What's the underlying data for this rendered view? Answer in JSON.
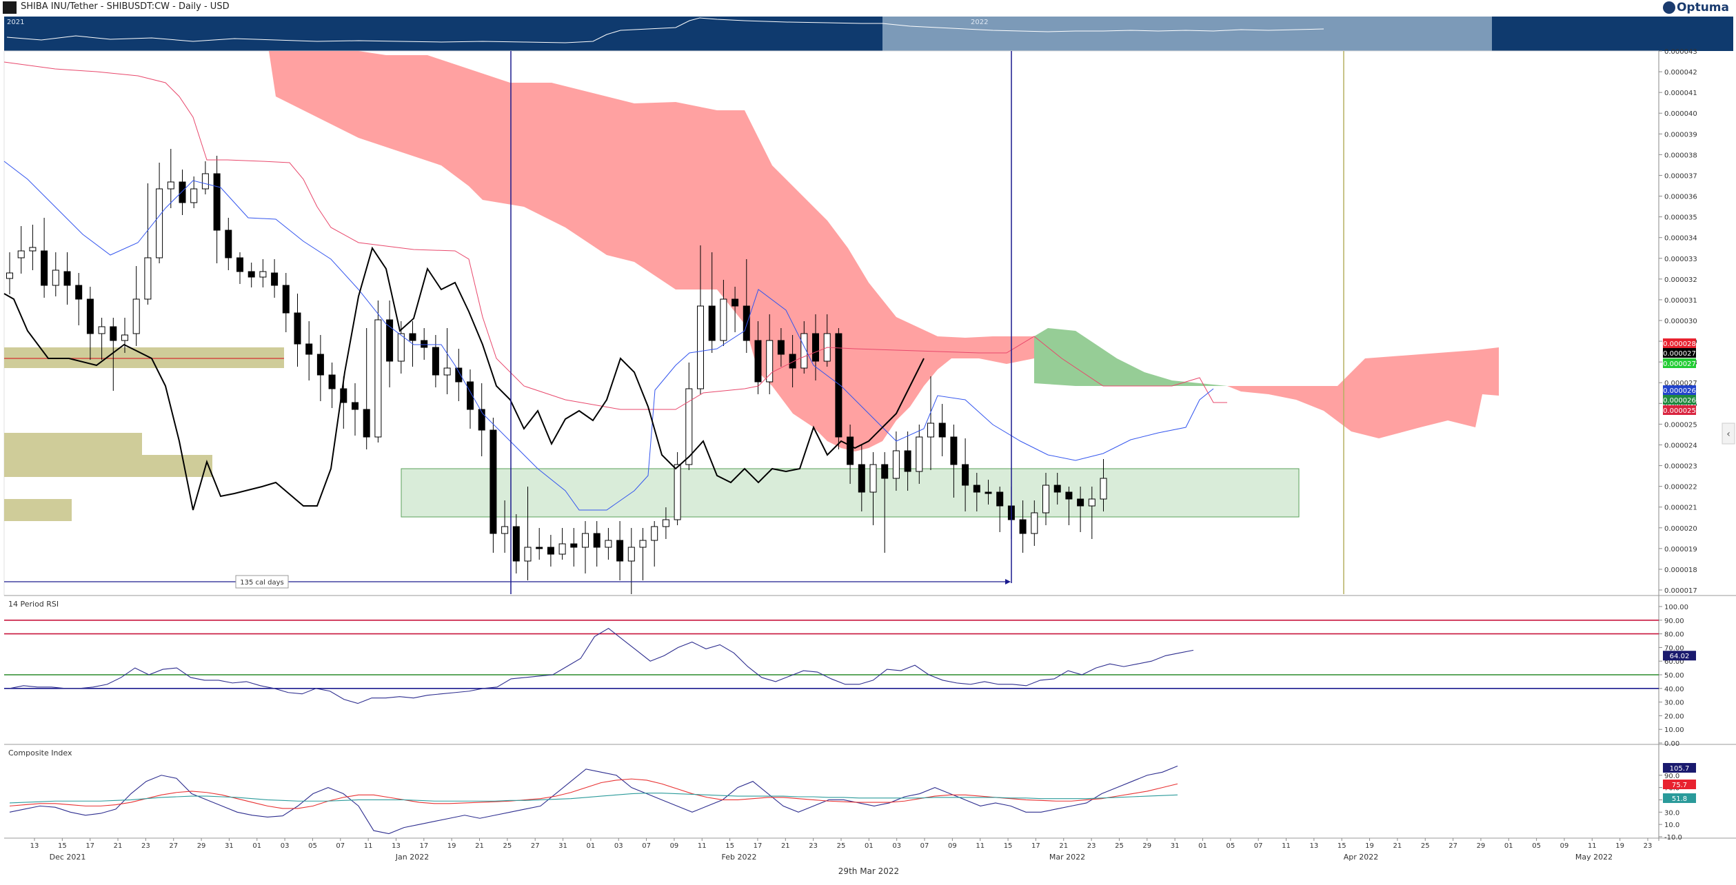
{
  "header": {
    "title": "SHIBA INU/Tether - SHIBUSDT:CW - Daily - USD",
    "logo": "Optuma",
    "menu_icon": "chart-menu-icon"
  },
  "navigator": {
    "year_labels": [
      "2021",
      "2022"
    ]
  },
  "colors": {
    "navigator_bg": "#0f3a6e",
    "cloud_bearish": "#ff8a8a",
    "cloud_bullish": "#7cc07c",
    "kijun": "#e8476b",
    "tenkan": "#3355ee",
    "chikou": "#000000",
    "support_zone": "#d9ecd9",
    "supply_zone": "#cfcc99"
  },
  "chart_data": [
    {
      "type": "candlestick",
      "panel": "price",
      "title": "SHIBA INU/Tether - SHIBUSDT:CW - Daily - USD",
      "ylim": [
        1.7e-05,
        4.3e-05
      ],
      "y_ticks": [
        "0.000017",
        "0.000018",
        "0.000019",
        "0.000020",
        "0.000021",
        "0.000022",
        "0.000023",
        "0.000024",
        "0.000025",
        "0.000026",
        "0.000027",
        "0.000028",
        "0.000029",
        "0.000030",
        "0.000031",
        "0.000032",
        "0.000033",
        "0.000034",
        "0.000035",
        "0.000036",
        "0.000037",
        "0.000038",
        "0.000039",
        "0.000040",
        "0.000041",
        "0.000042",
        "0.000043"
      ],
      "last_values": [
        {
          "label": "0.000028",
          "color": "#e8222f"
        },
        {
          "label": "0.000027",
          "color": "#000000"
        },
        {
          "label": "0.000027",
          "color": "#22cc33"
        },
        {
          "label": "0.000026",
          "color": "#2244cc"
        },
        {
          "label": "0.000026",
          "color": "#1f8a3f"
        },
        {
          "label": "0.000025",
          "color": "#d9243f"
        }
      ],
      "annotation": "135 cal days",
      "indicators": [
        "Ichimoku Cloud",
        "Tenkan-sen",
        "Kijun-sen",
        "Chikou Span"
      ],
      "grid": false
    },
    {
      "type": "line",
      "panel": "rsi",
      "title": "14 Period RSI",
      "ylim": [
        0,
        100
      ],
      "y_ticks": [
        "0.00",
        "10.00",
        "20.00",
        "30.00",
        "40.00",
        "50.00",
        "60.00",
        "70.00",
        "80.00",
        "90.00",
        "100.00"
      ],
      "levels": [
        90,
        80,
        50,
        40
      ],
      "last_value": "64.02",
      "grid": false
    },
    {
      "type": "line",
      "panel": "composite",
      "title": "Composite Index",
      "y_ticks": [
        "-10.0",
        "10.0",
        "30.0",
        "50.0",
        "70.0",
        "90.0"
      ],
      "last_values": [
        {
          "label": "105.7",
          "color": "#1a1a6e"
        },
        {
          "label": "75.7",
          "color": "#e8222f"
        },
        {
          "label": "51.8",
          "color": "#2a9a9a"
        }
      ],
      "grid": false
    }
  ],
  "x_axis": {
    "days": [
      "13",
      "15",
      "17",
      "21",
      "23",
      "27",
      "29",
      "31",
      "01",
      "03",
      "05",
      "07",
      "11",
      "13",
      "17",
      "19",
      "21",
      "25",
      "27",
      "31",
      "01",
      "03",
      "07",
      "09",
      "11",
      "15",
      "17",
      "21",
      "23",
      "25",
      "01",
      "03",
      "07",
      "09",
      "11",
      "15",
      "17",
      "21",
      "23",
      "25",
      "29",
      "31",
      "01",
      "05",
      "07",
      "11",
      "13",
      "15",
      "19",
      "21",
      "25",
      "27",
      "29",
      "01",
      "05",
      "09",
      "11",
      "19",
      "23"
    ],
    "months": [
      "Dec 2021",
      "Jan 2022",
      "Feb 2022",
      "Mar 2022",
      "Apr 2022",
      "May 2022"
    ],
    "footer_date": "29th Mar 2022"
  }
}
